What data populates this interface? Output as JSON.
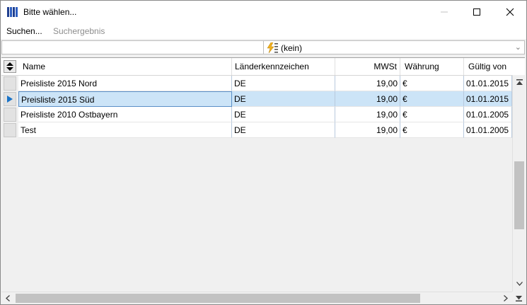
{
  "window": {
    "title": "Bitte wählen...",
    "icons": {
      "app": "app-list-icon",
      "minimize": "minimize-icon",
      "maximize": "maximize-icon",
      "close": "close-icon"
    }
  },
  "menu": {
    "items": [
      {
        "label": "Suchen...",
        "enabled": true
      },
      {
        "label": "Suchergebnis",
        "enabled": false
      }
    ]
  },
  "filter": {
    "search_value": "",
    "combo_value": "(kein)",
    "combo_icon": "flash-list-icon"
  },
  "table": {
    "columns": [
      "Name",
      "Länderkennzeichen",
      "MWSt",
      "Währung",
      "Gültig von"
    ],
    "rows": [
      {
        "name": "Preisliste 2015 Nord",
        "country": "DE",
        "vat": "19,00",
        "currency": "€",
        "valid_from": "01.01.2015",
        "selected": false
      },
      {
        "name": "Preisliste 2015 Süd",
        "country": "DE",
        "vat": "19,00",
        "currency": "€",
        "valid_from": "01.01.2015",
        "selected": true
      },
      {
        "name": "Preisliste 2010 Ostbayern",
        "country": "DE",
        "vat": "19,00",
        "currency": "€",
        "valid_from": "01.01.2005",
        "selected": false
      },
      {
        "name": "Test",
        "country": "DE",
        "vat": "19,00",
        "currency": "€",
        "valid_from": "01.01.2005",
        "selected": false
      }
    ]
  },
  "colors": {
    "selection": "#cce4f7",
    "selection_border": "#5b8fc7",
    "row_indicator": "#1a73c7"
  }
}
